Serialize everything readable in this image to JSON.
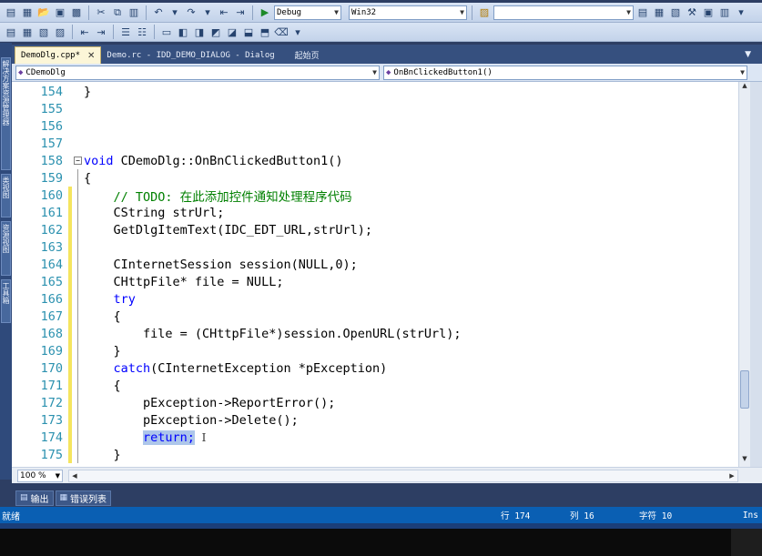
{
  "toolbar1": {
    "config_combo": "Debug",
    "platform_combo": "Win32",
    "find_combo": ""
  },
  "side_tabs": [
    "解决方案资源管理器",
    "类视图",
    "资源视图",
    "工具箱"
  ],
  "doc_tabs": [
    {
      "label": "DemoDlg.cpp*",
      "active": true
    },
    {
      "label": "Demo.rc - IDD_DEMO_DIALOG - Dialog",
      "active": false
    },
    {
      "label": "起始页",
      "active": false
    }
  ],
  "navbar": {
    "class_combo": "CDemoDlg",
    "member_combo": "OnBnClickedButton1()"
  },
  "code_lines": [
    {
      "n": "154",
      "parts": [
        {
          "t": "}",
          "k": "n"
        }
      ]
    },
    {
      "n": "155",
      "parts": []
    },
    {
      "n": "156",
      "parts": []
    },
    {
      "n": "157",
      "parts": []
    },
    {
      "n": "158",
      "parts": [
        {
          "t": "void",
          "k": "kw"
        },
        {
          "t": " CDemoDlg::OnBnClickedButton1()",
          "k": "n"
        }
      ]
    },
    {
      "n": "159",
      "parts": [
        {
          "t": "{",
          "k": "n"
        }
      ]
    },
    {
      "n": "160",
      "parts": [
        {
          "t": "    // TODO: 在此添加控件通知处理程序代码",
          "k": "cm"
        }
      ]
    },
    {
      "n": "161",
      "parts": [
        {
          "t": "    CString strUrl;",
          "k": "n"
        }
      ]
    },
    {
      "n": "162",
      "parts": [
        {
          "t": "    GetDlgItemText(IDC_EDT_URL,strUrl);",
          "k": "n"
        }
      ]
    },
    {
      "n": "163",
      "parts": []
    },
    {
      "n": "164",
      "parts": [
        {
          "t": "    CInternetSession session(NULL,0);",
          "k": "n"
        }
      ]
    },
    {
      "n": "165",
      "parts": [
        {
          "t": "    CHttpFile* file = NULL;",
          "k": "n"
        }
      ]
    },
    {
      "n": "166",
      "parts": [
        {
          "t": "    ",
          "k": "n"
        },
        {
          "t": "try",
          "k": "kw"
        }
      ]
    },
    {
      "n": "167",
      "parts": [
        {
          "t": "    {",
          "k": "n"
        }
      ]
    },
    {
      "n": "168",
      "parts": [
        {
          "t": "        file = (CHttpFile*)session.OpenURL(strUrl);",
          "k": "n"
        }
      ]
    },
    {
      "n": "169",
      "parts": [
        {
          "t": "    }",
          "k": "n"
        }
      ]
    },
    {
      "n": "170",
      "parts": [
        {
          "t": "    ",
          "k": "n"
        },
        {
          "t": "catch",
          "k": "kw"
        },
        {
          "t": "(CInternetException *pException)",
          "k": "n"
        }
      ]
    },
    {
      "n": "171",
      "parts": [
        {
          "t": "    {",
          "k": "n"
        }
      ]
    },
    {
      "n": "172",
      "parts": [
        {
          "t": "        pException->ReportError();",
          "k": "n"
        }
      ]
    },
    {
      "n": "173",
      "parts": [
        {
          "t": "        pException->Delete();",
          "k": "n"
        }
      ]
    },
    {
      "n": "174",
      "parts": [
        {
          "t": "        ",
          "k": "n"
        },
        {
          "t": "return;",
          "k": "sel"
        }
      ]
    },
    {
      "n": "175",
      "parts": [
        {
          "t": "    }",
          "k": "n"
        }
      ]
    }
  ],
  "editor_bottom": {
    "zoom": "100 %"
  },
  "output_tabs": [
    {
      "label": "输出",
      "icon": "output-icon"
    },
    {
      "label": "错误列表",
      "icon": "error-list-icon"
    }
  ],
  "status": {
    "text": "就绪",
    "line": "行 174",
    "col": "列 16",
    "char": "字符 10",
    "mode": "Ins"
  }
}
